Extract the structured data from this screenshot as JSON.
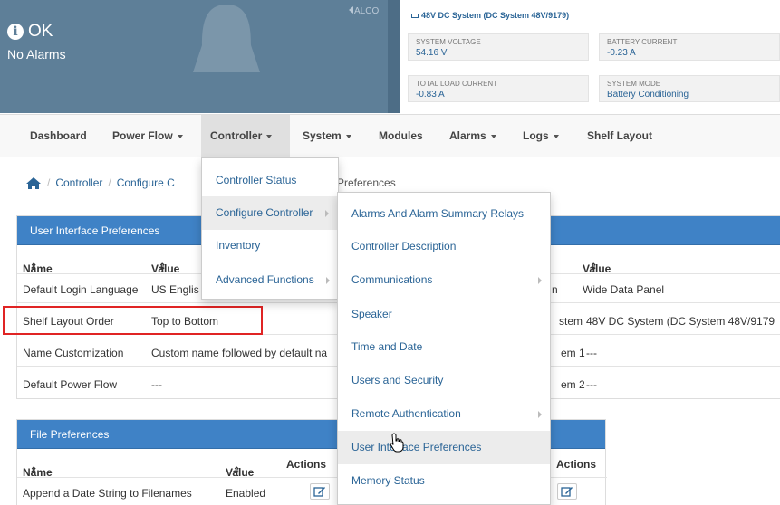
{
  "status": {
    "state": "OK",
    "alarms": "No Alarms",
    "alco_label": "ALCO"
  },
  "system": {
    "title": "48V DC System (DC System 48V/9179)",
    "metrics": [
      {
        "label": "SYSTEM VOLTAGE",
        "value": "54.16 V"
      },
      {
        "label": "BATTERY CURRENT",
        "value": "-0.23 A"
      },
      {
        "label": "TOTAL LOAD CURRENT",
        "value": "-0.83 A"
      },
      {
        "label": "SYSTEM MODE",
        "value": "Battery Conditioning"
      }
    ]
  },
  "nav": {
    "items": [
      {
        "label": "Dashboard"
      },
      {
        "label": "Power Flow"
      },
      {
        "label": "Controller"
      },
      {
        "label": "System"
      },
      {
        "label": "Modules"
      },
      {
        "label": "Alarms"
      },
      {
        "label": "Logs"
      },
      {
        "label": "Shelf Layout"
      }
    ]
  },
  "breadcrumb": {
    "items": [
      "Controller",
      "Configure C"
    ],
    "current": "Preferences"
  },
  "ui_prefs": {
    "title": "User Interface Preferences",
    "col_name": "Name",
    "col_value": "Value",
    "rows": [
      {
        "name": "Default Login Language",
        "value": "US Englis"
      },
      {
        "name": "Shelf Layout Order",
        "value": "Top to Bottom"
      },
      {
        "name": "Name Customization",
        "value": "Custom name followed by default na"
      },
      {
        "name": "Default Power Flow",
        "value": "---"
      }
    ]
  },
  "right_table": {
    "col_value": "Value",
    "rows": [
      {
        "name": "n",
        "value": "Wide Data Panel"
      },
      {
        "name": "stem",
        "value": "48V DC System (DC System 48V/9179"
      },
      {
        "name": "em 1",
        "value": "---"
      },
      {
        "name": "em 2",
        "value": "---"
      }
    ]
  },
  "file_prefs": {
    "title": "File Preferences",
    "col_name": "Name",
    "col_value": "Value",
    "col_actions": "Actions",
    "col_actions2": "Actions",
    "rows": [
      {
        "name": "Append a Date String to Filenames",
        "value": "Enabled"
      }
    ]
  },
  "controller_menu": {
    "items": [
      "Controller Status",
      "Configure Controller",
      "Inventory",
      "Advanced Functions"
    ]
  },
  "configure_menu": {
    "items": [
      "Alarms And Alarm Summary Relays",
      "Controller Description",
      "Communications",
      "Speaker",
      "Time and Date",
      "Users and Security",
      "Remote Authentication",
      "User Interface Preferences",
      "Memory Status"
    ]
  },
  "colors": {
    "banner": "#5e7f98",
    "panel_header": "#3f82c6",
    "link": "#2a6496",
    "highlight": "#e02424"
  }
}
